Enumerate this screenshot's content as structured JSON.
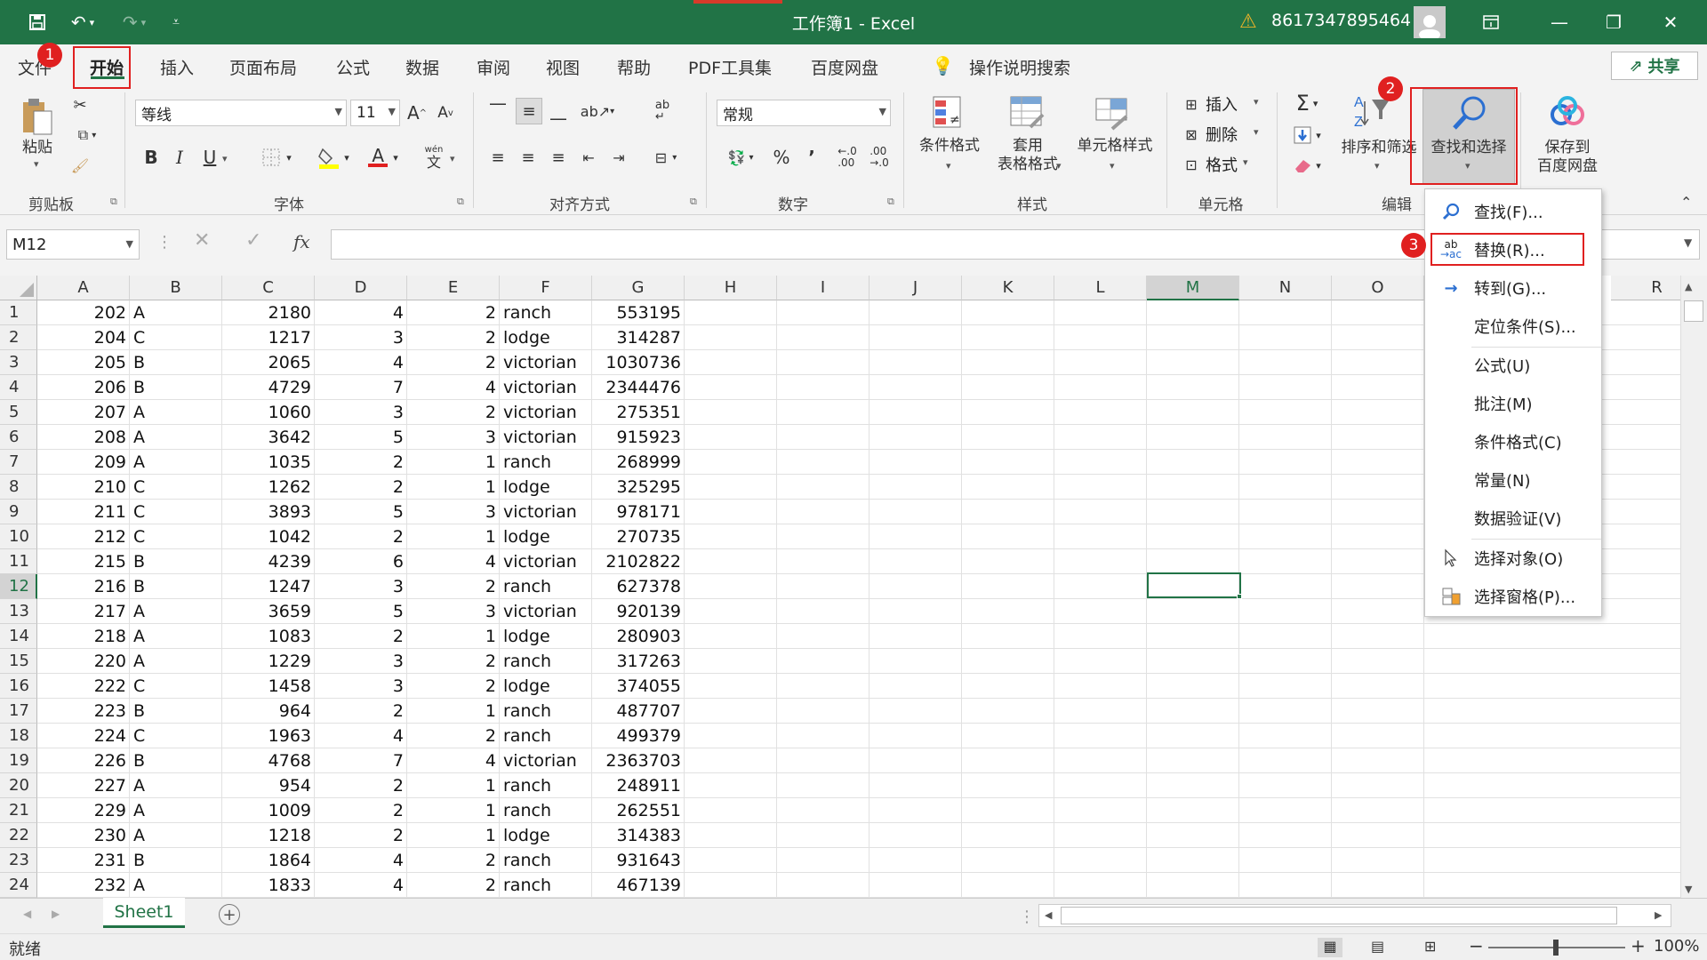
{
  "titlebar": {
    "title": "工作簿1  -  Excel",
    "account": "8617347895464"
  },
  "tabs": [
    "文件",
    "开始",
    "插入",
    "页面布局",
    "公式",
    "数据",
    "审阅",
    "视图",
    "帮助",
    "PDF工具集",
    "百度网盘"
  ],
  "tell_me": "操作说明搜索",
  "share_label": "共享",
  "ribbon": {
    "clipboard": {
      "paste": "粘贴",
      "group": "剪贴板"
    },
    "font": {
      "name": "等线",
      "size": "11",
      "bold": "B",
      "italic": "I",
      "underline": "U",
      "grow": "A",
      "shrink": "A",
      "color_a": "A",
      "wen": "wén",
      "group": "字体"
    },
    "alignment": {
      "group": "对齐方式"
    },
    "number": {
      "format": "常规",
      "percent": "%",
      "comma": "’",
      "inc_dec": "←.0\n.00",
      "dec_dec": ".00\n→.0",
      "group": "数字"
    },
    "styles": {
      "cond": "条件格式",
      "table": "套用\n表格格式",
      "cell": "单元格样式",
      "group": "样式"
    },
    "cells": {
      "insert": "插入",
      "delete": "删除",
      "format": "格式",
      "group": "单元格"
    },
    "editing": {
      "sort": "排序和筛选",
      "find": "查找和选择",
      "group": "编辑"
    },
    "baidu": {
      "save": "保存到\n百度网盘"
    }
  },
  "namebox": "M12",
  "fx": "fx",
  "columns": [
    "A",
    "B",
    "C",
    "D",
    "E",
    "F",
    "G",
    "H",
    "I",
    "J",
    "K",
    "L",
    "M",
    "N",
    "O",
    "R"
  ],
  "rows": [
    [
      202,
      "A",
      2180,
      4,
      2,
      "ranch",
      553195
    ],
    [
      204,
      "C",
      1217,
      3,
      2,
      "lodge",
      314287
    ],
    [
      205,
      "B",
      2065,
      4,
      2,
      "victorian",
      1030736
    ],
    [
      206,
      "B",
      4729,
      7,
      4,
      "victorian",
      2344476
    ],
    [
      207,
      "A",
      1060,
      3,
      2,
      "victorian",
      275351
    ],
    [
      208,
      "A",
      3642,
      5,
      3,
      "victorian",
      915923
    ],
    [
      209,
      "A",
      1035,
      2,
      1,
      "ranch",
      268999
    ],
    [
      210,
      "C",
      1262,
      2,
      1,
      "lodge",
      325295
    ],
    [
      211,
      "C",
      3893,
      5,
      3,
      "victorian",
      978171
    ],
    [
      212,
      "C",
      1042,
      2,
      1,
      "lodge",
      270735
    ],
    [
      215,
      "B",
      4239,
      6,
      4,
      "victorian",
      2102822
    ],
    [
      216,
      "B",
      1247,
      3,
      2,
      "ranch",
      627378
    ],
    [
      217,
      "A",
      3659,
      5,
      3,
      "victorian",
      920139
    ],
    [
      218,
      "A",
      1083,
      2,
      1,
      "lodge",
      280903
    ],
    [
      220,
      "A",
      1229,
      3,
      2,
      "ranch",
      317263
    ],
    [
      222,
      "C",
      1458,
      3,
      2,
      "lodge",
      374055
    ],
    [
      223,
      "B",
      964,
      2,
      1,
      "ranch",
      487707
    ],
    [
      224,
      "C",
      1963,
      4,
      2,
      "ranch",
      499379
    ],
    [
      226,
      "B",
      4768,
      7,
      4,
      "victorian",
      2363703
    ],
    [
      227,
      "A",
      954,
      2,
      1,
      "ranch",
      248911
    ],
    [
      229,
      "A",
      1009,
      2,
      1,
      "ranch",
      262551
    ],
    [
      230,
      "A",
      1218,
      2,
      1,
      "lodge",
      314383
    ],
    [
      231,
      "B",
      1864,
      4,
      2,
      "ranch",
      931643
    ],
    [
      232,
      "A",
      1833,
      4,
      2,
      "ranch",
      467139
    ]
  ],
  "sheet_tab": "Sheet1",
  "status": "就绪",
  "zoom": "100%",
  "menu": {
    "find": "查找(F)...",
    "replace": "替换(R)...",
    "goto": "转到(G)...",
    "goto_special": "定位条件(S)...",
    "formulas": "公式(U)",
    "comments": "批注(M)",
    "cond_format": "条件格式(C)",
    "constants": "常量(N)",
    "validation": "数据验证(V)",
    "select_objects": "选择对象(O)",
    "selection_pane": "选择窗格(P)..."
  },
  "badges": [
    "1",
    "2",
    "3"
  ],
  "colors": {
    "excel_green": "#217346",
    "annotation_red": "#e02020"
  }
}
